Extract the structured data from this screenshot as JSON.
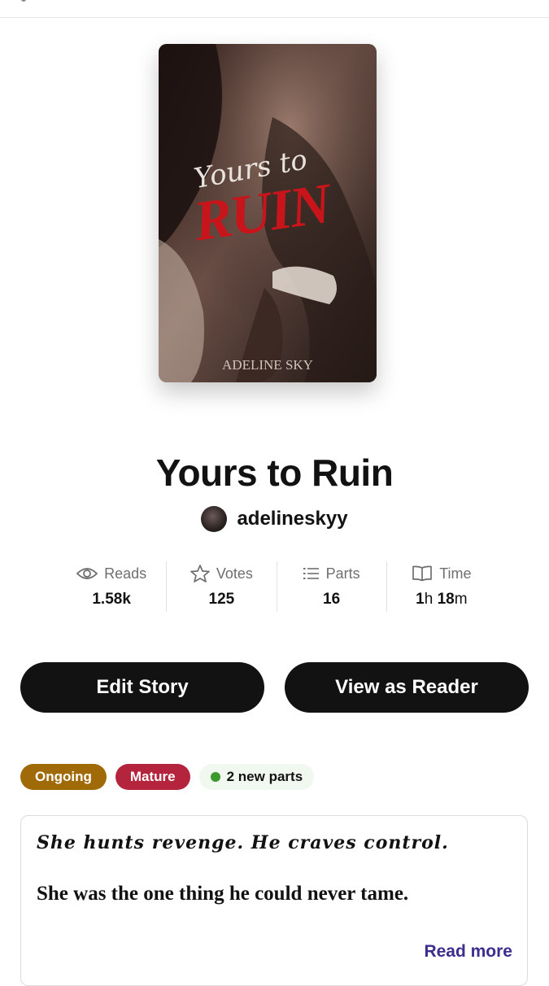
{
  "story": {
    "title": "Yours to Ruin",
    "author": "adelineskyy",
    "cover": {
      "script_title": "Yours to",
      "main_title": "RUIN",
      "author_credit": "ADELINE SKY"
    }
  },
  "stats": [
    {
      "icon": "eye-icon",
      "label": "Reads",
      "value": "1.58k"
    },
    {
      "icon": "star-icon",
      "label": "Votes",
      "value": "125"
    },
    {
      "icon": "list-icon",
      "label": "Parts",
      "value": "16"
    },
    {
      "icon": "book-icon",
      "label": "Time",
      "value_hours": "1",
      "unit_h": "h",
      "value_minutes": "18",
      "unit_m": "m"
    }
  ],
  "buttons": {
    "edit": "Edit Story",
    "view": "View as Reader"
  },
  "tags": {
    "status": "Ongoing",
    "rating": "Mature",
    "new_parts": "2 new parts"
  },
  "description": {
    "line1": "She hunts revenge. He craves control.",
    "line2": "She was the one thing he could never tame.",
    "read_more": "Read more"
  },
  "colors": {
    "ongoing": "#a06a08",
    "mature": "#b4243c",
    "new_dot": "#3b9a2c",
    "link": "#3d2d8e",
    "button": "#121212"
  }
}
